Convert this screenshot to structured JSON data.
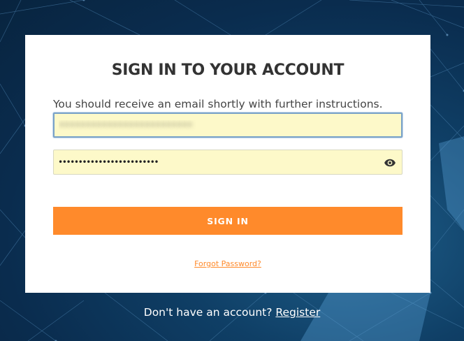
{
  "login": {
    "title": "SIGN IN TO YOUR ACCOUNT",
    "message": "You should receive an email shortly with further instructions.",
    "email_value": "•••••••••••••••••••••••••",
    "password_value": "•••••••••••••••••••••••••",
    "signin_label": "SIGN IN",
    "forgot_label": "Forgot Password?"
  },
  "footer": {
    "prompt": "Don't have an account?",
    "register_label": "Register"
  },
  "icons": {
    "password_toggle": "eye-icon"
  },
  "colors": {
    "accent": "#ff8a2b",
    "field_background": "#fdf9c9",
    "background": "#0f3f66"
  }
}
